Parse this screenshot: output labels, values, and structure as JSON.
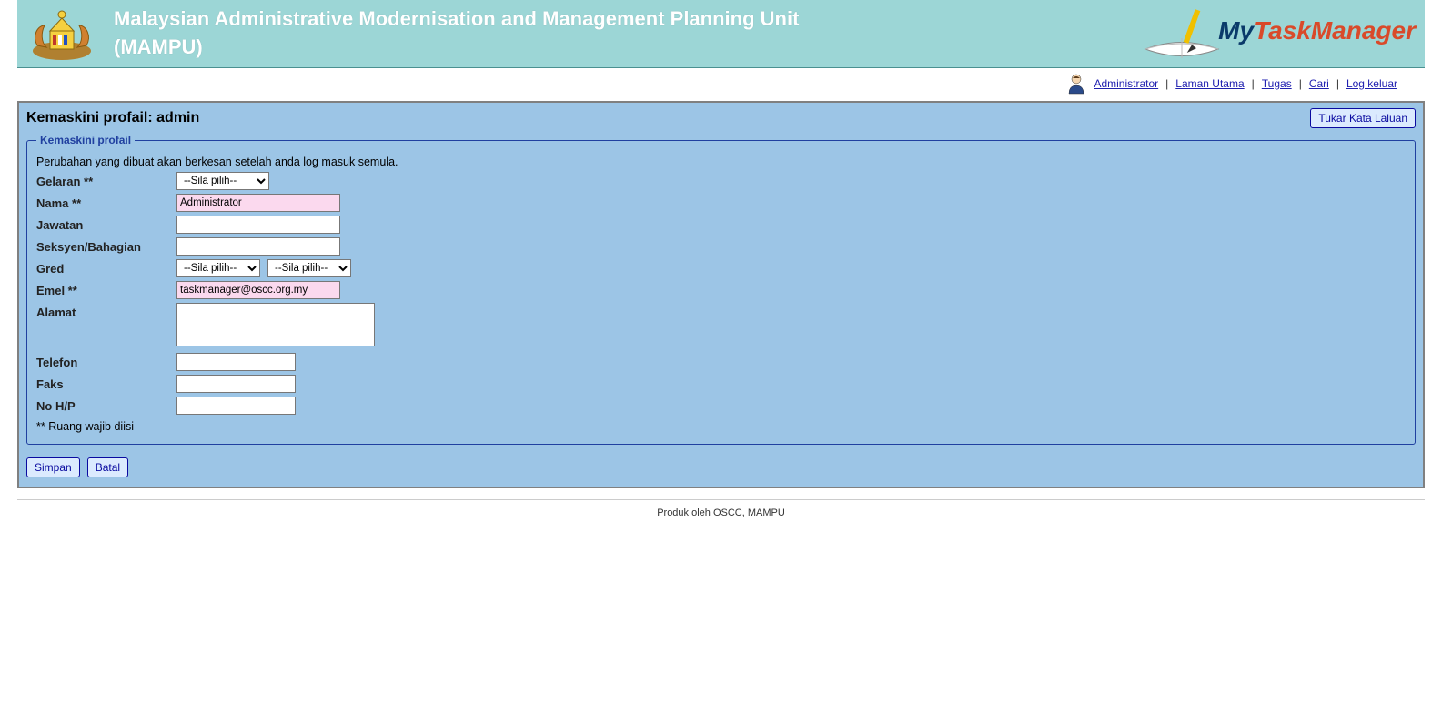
{
  "header": {
    "title_line1": "Malaysian Administrative Modernisation and Management Planning Unit",
    "title_line2": "(MAMPU)",
    "logo_my": "My",
    "logo_task": "Task",
    "logo_manager": "Manager"
  },
  "topnav": {
    "user": "Administrator",
    "links": {
      "home": "Laman Utama",
      "tasks": "Tugas",
      "search": "Cari",
      "logout": "Log keluar"
    }
  },
  "page": {
    "title": "Kemaskini profail: admin",
    "change_password_btn": "Tukar Kata Laluan"
  },
  "form": {
    "legend": "Kemaskini profail",
    "note": "Perubahan yang dibuat akan berkesan setelah anda log masuk semula.",
    "fields": {
      "gelaran_label": "Gelaran **",
      "gelaran_select": "--Sila pilih--",
      "nama_label": "Nama **",
      "nama_value": "Administrator",
      "jawatan_label": "Jawatan",
      "jawatan_value": "",
      "seksyen_label": "Seksyen/Bahagian",
      "seksyen_value": "",
      "gred_label": "Gred",
      "gred_select1": "--Sila pilih--",
      "gred_select2": "--Sila pilih--",
      "emel_label": "Emel **",
      "emel_value": "taskmanager@oscc.org.my",
      "alamat_label": "Alamat",
      "alamat_value": "",
      "telefon_label": "Telefon",
      "telefon_value": "",
      "faks_label": "Faks",
      "faks_value": "",
      "nohp_label": "No H/P",
      "nohp_value": ""
    },
    "required_note": "** Ruang wajib diisi",
    "save_btn": "Simpan",
    "cancel_btn": "Batal"
  },
  "footer": {
    "text": "Produk oleh OSCC, MAMPU"
  }
}
